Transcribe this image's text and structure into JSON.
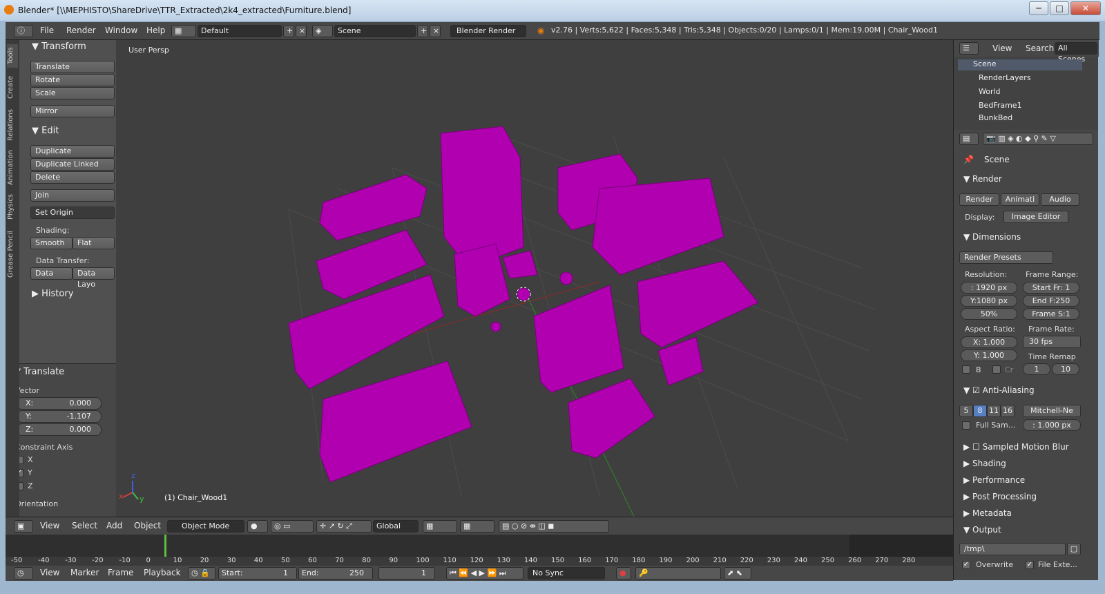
{
  "window": {
    "title": "Blender* [\\\\MEPHISTO\\ShareDrive\\TTR_Extracted\\2k4_extracted\\Furniture.blend]",
    "minimize": "─",
    "maximize": "□",
    "close": "✕"
  },
  "info_header": {
    "menus": [
      "File",
      "Render",
      "Window",
      "Help"
    ],
    "layout": "Default",
    "scene": "Scene",
    "engine": "Blender Render",
    "stats": "v2.76 | Verts:5,622 | Faces:5,348 | Tris:5,348 | Objects:0/20 | Lamps:0/1 | Mem:19.00M | Chair_Wood1"
  },
  "tool_tabs": [
    "Tools",
    "Create",
    "Relations",
    "Animation",
    "Physics",
    "Grease Pencil"
  ],
  "tools": {
    "transform_title": "Transform",
    "translate": "Translate",
    "rotate": "Rotate",
    "scale": "Scale",
    "mirror": "Mirror",
    "edit_title": "Edit",
    "duplicate": "Duplicate",
    "duplicate_linked": "Duplicate Linked",
    "delete": "Delete",
    "join": "Join",
    "set_origin": "Set Origin",
    "shading_label": "Shading:",
    "smooth": "Smooth",
    "flat": "Flat",
    "data_transfer_label": "Data Transfer:",
    "data": "Data",
    "data_layo": "Data Layo",
    "history_title": "History"
  },
  "operator": {
    "title": "Translate",
    "vector_label": "Vector",
    "x_k": "X:",
    "x_v": "0.000",
    "y_k": "Y:",
    "y_v": "-1.107",
    "z_k": "Z:",
    "z_v": "0.000",
    "constraint_label": "Constraint Axis",
    "cx": "X",
    "cy": "Y",
    "cz": "Z",
    "orientation_label": "Orientation"
  },
  "viewport": {
    "persp": "User Persp",
    "object_label": "(1) Chair_Wood1",
    "axis_x": "x",
    "axis_y": "y",
    "axis_z": "z",
    "colors": {
      "furniture": "#b000b0",
      "grid": "#4a4a4a",
      "bg": "#3f3f3f"
    }
  },
  "view3d_header": {
    "menus": [
      "View",
      "Select",
      "Add",
      "Object"
    ],
    "mode": "Object Mode",
    "orientation": "Global"
  },
  "timeline": {
    "ticks": [
      "-50",
      "-40",
      "-30",
      "-20",
      "-10",
      "0",
      "10",
      "20",
      "30",
      "40",
      "50",
      "60",
      "70",
      "80",
      "90",
      "100",
      "110",
      "120",
      "130",
      "140",
      "150",
      "160",
      "170",
      "180",
      "190",
      "200",
      "210",
      "220",
      "230",
      "240",
      "250",
      "260",
      "270",
      "280"
    ],
    "menus": [
      "View",
      "Marker",
      "Frame",
      "Playback"
    ],
    "start_k": "Start:",
    "start_v": "1",
    "end_k": "End:",
    "end_v": "250",
    "current": "1",
    "sync": "No Sync"
  },
  "outliner": {
    "view": "View",
    "search": "Search",
    "all_scenes": "All Scenes",
    "items": [
      "Scene",
      "RenderLayers",
      "World",
      "BedFrame1",
      "BunkBed"
    ]
  },
  "properties": {
    "scene": "Scene",
    "render_title": "Render",
    "render_btn": "Render",
    "anim_btn": "Animati",
    "audio_btn": "Audio",
    "display_label": "Display:",
    "display_value": "Image Editor",
    "dimensions_title": "Dimensions",
    "presets": "Render Presets",
    "resolution_label": "Resolution:",
    "frame_range_label": "Frame Range:",
    "res_x": ": 1920 px",
    "res_y": "Y:1080 px",
    "res_pct": "50%",
    "start_fr": "Start Fr: 1",
    "end_f": "End F:250",
    "frame_s": "Frame S:1",
    "aspect_label": "Aspect Ratio:",
    "frame_rate_label": "Frame Rate:",
    "asp_x_k": "X:",
    "asp_x_v": "1.000",
    "asp_y_k": "Y:",
    "asp_y_v": "1.000",
    "fps": "30 fps",
    "time_remap": "Time Remap",
    "b": "B",
    "cr": "Cr",
    "remap_old": "1",
    "remap_new": "10",
    "aa_title": "Anti-Aliasing",
    "aa_samples": [
      "5",
      "8",
      "11",
      "16"
    ],
    "filter": "Mitchell-Ne",
    "full_sam": "Full Sam...",
    "filter_size": ": 1.000 px",
    "motion_blur": "Sampled Motion Blur",
    "shading": "Shading",
    "performance": "Performance",
    "post_processing": "Post Processing",
    "metadata": "Metadata",
    "output_title": "Output",
    "output_path": "/tmp\\",
    "overwrite": "Overwrite",
    "file_ext": "File Exte..."
  }
}
